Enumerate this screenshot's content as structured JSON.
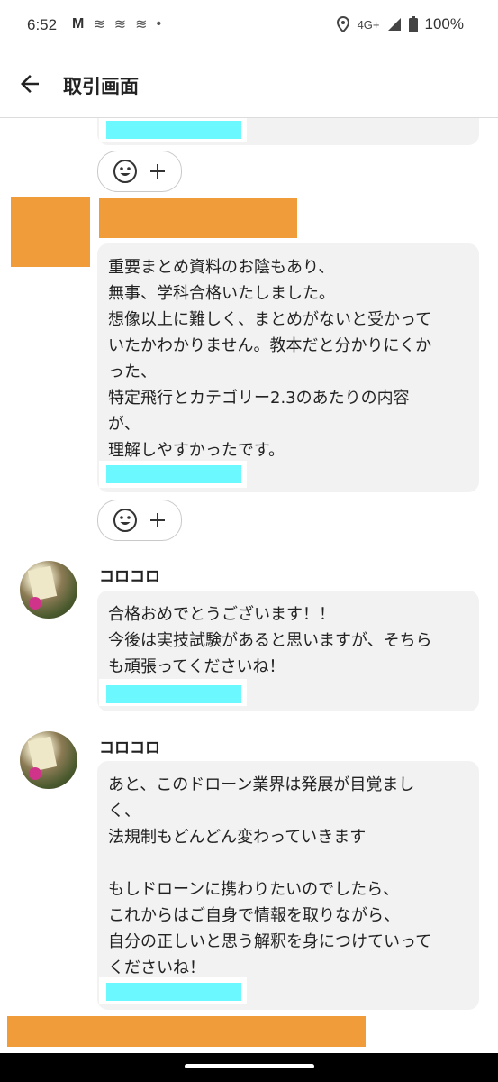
{
  "status_bar": {
    "time": "6:52",
    "notif_icons": [
      "M",
      "≋",
      "≋",
      "≋",
      "•"
    ],
    "network": "4G+",
    "battery": "100%"
  },
  "app_bar": {
    "title": "取引画面"
  },
  "messages": [
    {
      "text": "重要まとめ資料のお陰もあり、\n無事、学科合格いたしました。\n想像以上に難しく、まとめがないと受かって\nいたかわかりません。教本だと分かりにくか\nった、\n特定飛行とカテゴリー2.3のあたりの内容\nが、\n理解しやすかったです。"
    },
    {
      "sender": "コロコロ",
      "text": "合格おめでとうございます！！\n今後は実技試験があると思いますが、そちら\nも頑張ってくださいね！"
    },
    {
      "sender": "コロコロ",
      "text": "あと、このドローン業界は発展が目覚まし\nく、\n法規制もどんどん変わっていきます\n\nもしドローンに携わりたいのでしたら、\nこれからはご自身で情報を取りながら、\n自分の正しいと思う解釈を身につけていって\nくださいね！"
    }
  ],
  "colors": {
    "redaction_orange": "#f19c3b",
    "redaction_cyan": "#6cf8ff",
    "bubble_bg": "#f2f2f2"
  },
  "icons": {
    "back": "arrow-back-icon",
    "react": "smiley-icon",
    "add": "plus-icon"
  }
}
